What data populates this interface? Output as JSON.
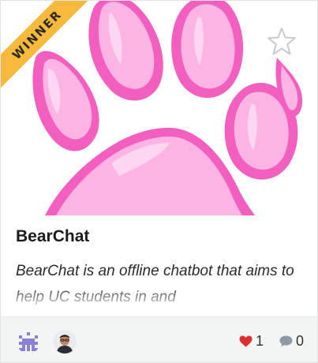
{
  "project": {
    "ribbon_label": "WINNER",
    "title": "BearChat",
    "description": "BearChat is an offline chatbot that aims to help UC students in and",
    "likes": "1",
    "comments": "0"
  },
  "icons": {
    "ribbon": "winner-ribbon",
    "star": "star-icon",
    "heart": "heart-icon",
    "comment": "comment-bubble-icon",
    "member_1": "team-member-avatar",
    "member_2": "team-member-avatar"
  },
  "colors": {
    "ribbon": "#f6b93b",
    "paw_outline": "#f25fbf",
    "paw_fill": "#fbb4e4",
    "paw_highlight": "#fdd6f1",
    "heart": "#e02d2d",
    "comment": "#8e9aa3",
    "avatar_1": "#8b7fd6"
  }
}
